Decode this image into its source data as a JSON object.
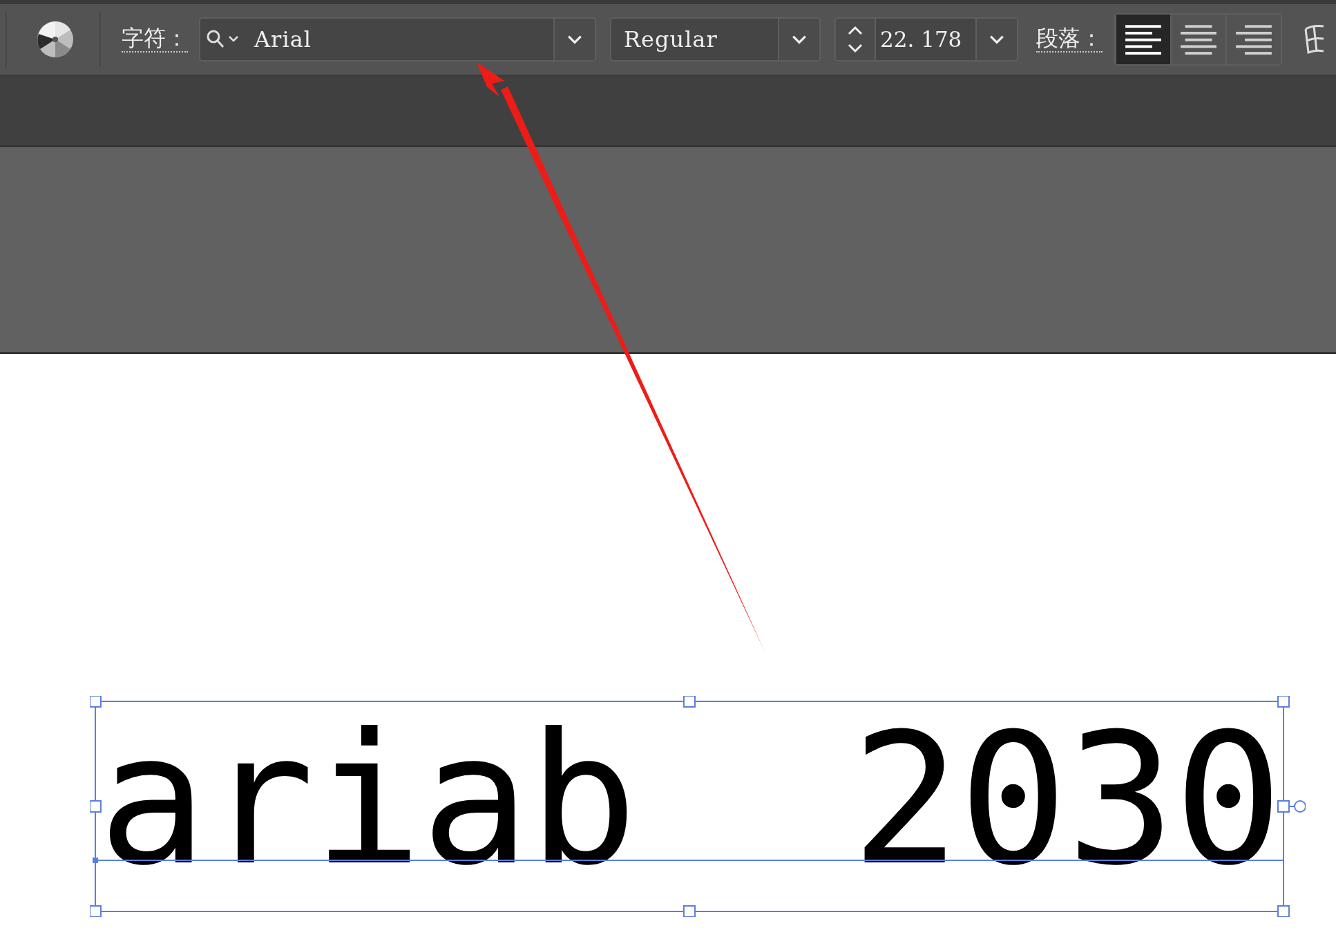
{
  "control_bar": {
    "character_label": "字符：",
    "font_family": "Arial",
    "font_style": "Regular",
    "font_size": "22. 178",
    "paragraph_label": "段落：",
    "alignments": [
      {
        "kind": "left",
        "selected": true
      },
      {
        "kind": "center",
        "selected": false
      },
      {
        "kind": "right",
        "selected": false
      }
    ]
  },
  "artboard": {
    "text_object": {
      "text": "ariab  2030",
      "selected": true
    }
  }
}
